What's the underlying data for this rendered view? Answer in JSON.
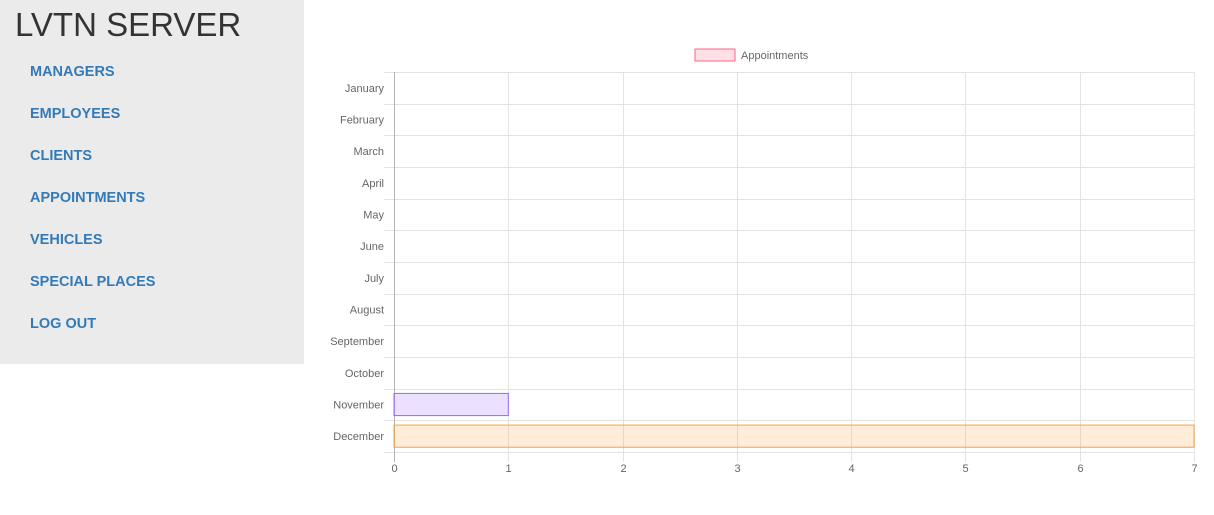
{
  "app": {
    "title": "LVTN SERVER"
  },
  "sidebar": {
    "items": [
      {
        "label": "MANAGERS"
      },
      {
        "label": "EMPLOYEES"
      },
      {
        "label": "CLIENTS"
      },
      {
        "label": "APPOINTMENTS"
      },
      {
        "label": "VEHICLES"
      },
      {
        "label": "SPECIAL PLACES"
      },
      {
        "label": "LOG OUT"
      }
    ],
    "link_color": "#337ab7",
    "background": "#ebebeb"
  },
  "chart_data": {
    "type": "bar",
    "orientation": "horizontal",
    "categories": [
      "January",
      "February",
      "March",
      "April",
      "May",
      "June",
      "July",
      "August",
      "September",
      "October",
      "November",
      "December"
    ],
    "series": [
      {
        "name": "Appointments",
        "values": [
          0,
          0,
          0,
          0,
          0,
          0,
          0,
          0,
          0,
          0,
          1,
          7
        ],
        "legend_fill": "rgba(255,99,132,0.2)",
        "legend_stroke": "rgba(255,99,132,1)"
      }
    ],
    "bar_colors": {
      "November": {
        "fill": "rgba(153,102,255,0.2)",
        "stroke": "rgba(153,102,255,1)"
      },
      "December": {
        "fill": "rgba(255,159,64,0.2)",
        "stroke": "rgba(255,159,64,1)"
      }
    },
    "x_ticks": [
      "0",
      "1",
      "2",
      "3",
      "4",
      "5",
      "6",
      "7"
    ],
    "xlim": [
      0,
      7
    ],
    "grid": true,
    "legend_position": "top"
  }
}
